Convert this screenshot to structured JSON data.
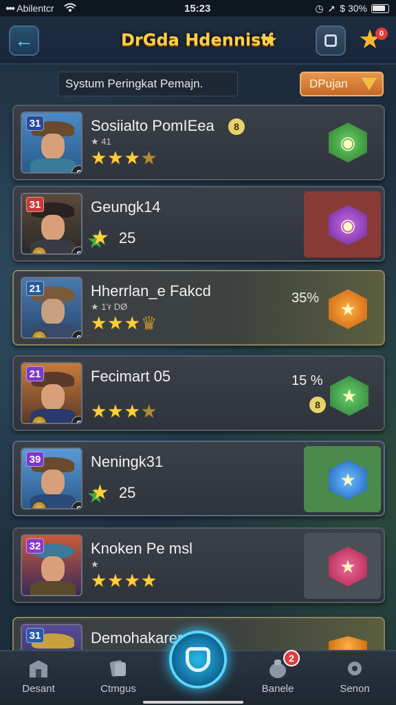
{
  "status_bar": {
    "carrier": "Abilentcr",
    "time": "15:23",
    "battery_text": "$ 30%"
  },
  "header": {
    "title": "DrGda Hdennisti",
    "fav_badge": "0"
  },
  "subtitle": "Systum Peringkat Pemajn.",
  "filter_label": "DPujan",
  "rows": [
    {
      "rank": "31",
      "name": "Sosiialto PomIEea",
      "sub": "★ 41",
      "stars": 4,
      "has_lock": true,
      "emblem_color": "#3a9a3a",
      "emblem_icon": "shield-icon",
      "panel": "none"
    },
    {
      "rank": "31",
      "name": "Geungk14",
      "score": "25",
      "emblem_color": "#9a3ac8",
      "emblem_icon": "gem-icon",
      "panel": "#8a3a36"
    },
    {
      "rank": "21",
      "name": "Hherrlan_e Fakcd",
      "sub": "★ 1’ғ DØ",
      "stars": 3,
      "pct": "35%",
      "emblem_color": "#e07a20",
      "emblem_icon": "star-icon",
      "panel": "gold"
    },
    {
      "rank": "21",
      "name": "Fecimart 05",
      "stars": 4,
      "pct": "15 %",
      "has_lock": true,
      "emblem_color": "#3a9a4a",
      "emblem_icon": "star-icon",
      "panel": "none"
    },
    {
      "rank": "39",
      "name": "Neningk31",
      "score": "25",
      "emblem_color": "#2a7ad8",
      "emblem_icon": "star-icon",
      "panel": "#4a8a4a"
    },
    {
      "rank": "32",
      "name": "Knoken Pe msl",
      "sub": "★",
      "stars": 4,
      "emblem_color": "#c8306a",
      "emblem_icon": "star-icon",
      "panel": "#4a4f58"
    },
    {
      "rank": "31",
      "name": "Demohakarery",
      "emblem_color": "#e08a20",
      "emblem_icon": "star-icon",
      "panel": "gold"
    }
  ],
  "nav": {
    "items": [
      "Desant",
      "Ctmgus",
      "Banele",
      "Senon"
    ],
    "badge": "2"
  },
  "colors": {
    "accent": "#ffcf4a",
    "rank_badges": [
      "#2a4a9a",
      "#c83a3a",
      "#2a5a9a",
      "#7a3ac8",
      "#7a3ac8",
      "#8a3ac8",
      "#2a5aaa"
    ]
  }
}
